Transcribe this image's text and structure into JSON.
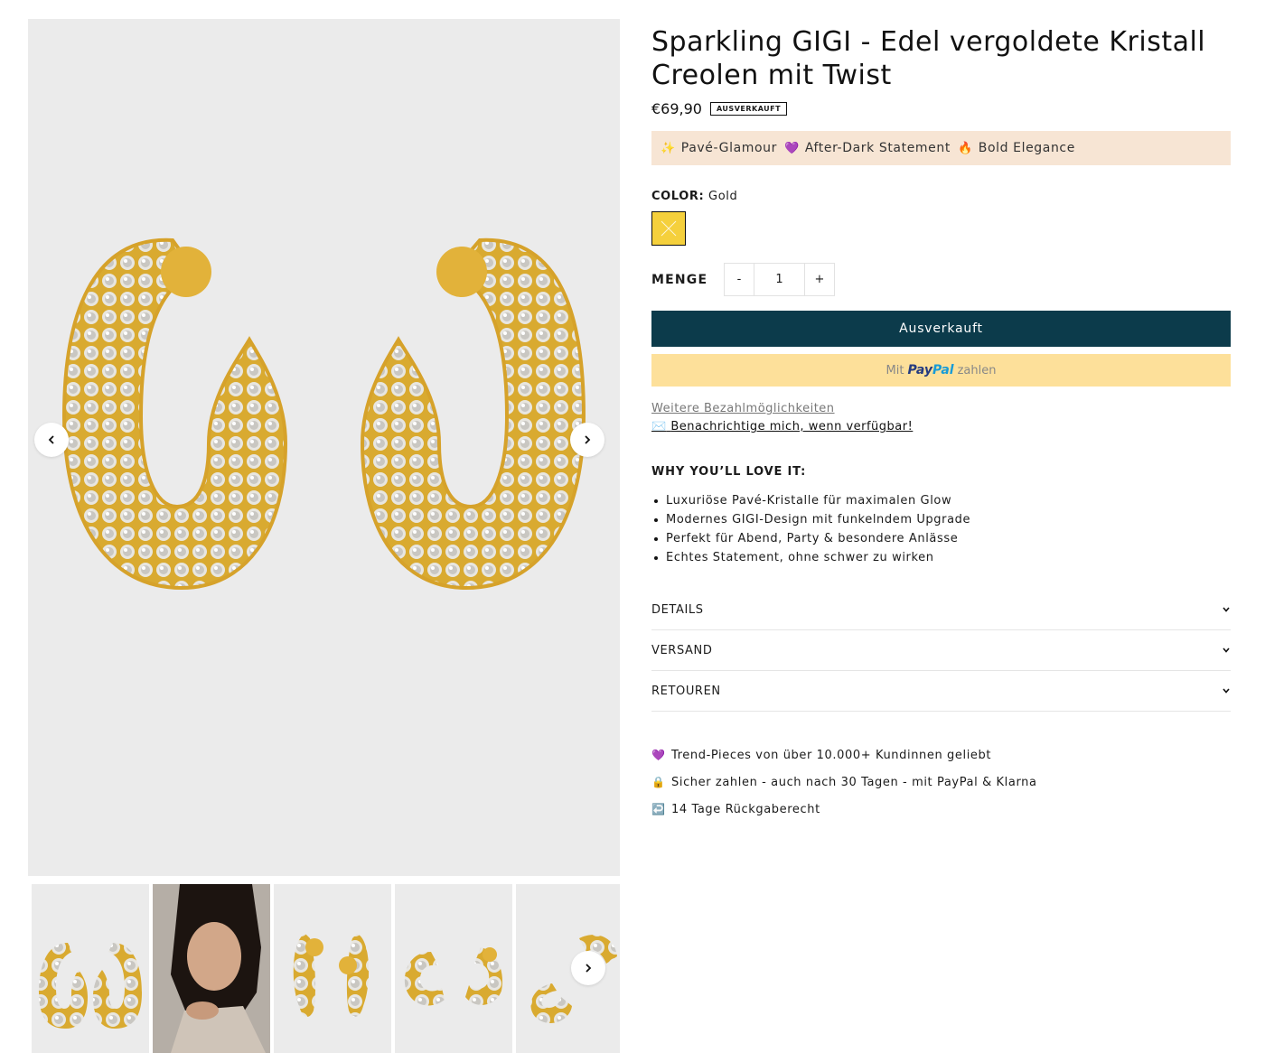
{
  "product": {
    "title": "Sparkling GIGI - Edel vergoldete Kristall Creolen mit Twist",
    "price": "€69,90",
    "badge": "AUSVERKAUFT"
  },
  "promo": [
    {
      "icon": "✨",
      "icon_name": "sparkles-icon",
      "text": "Pavé-Glamour"
    },
    {
      "icon": "💜",
      "icon_name": "heart-icon",
      "text": "After-Dark Statement"
    },
    {
      "icon": "🔥",
      "icon_name": "fire-icon",
      "text": "Bold Elegance"
    }
  ],
  "color": {
    "label": "COLOR:",
    "value": "Gold",
    "swatch": "#f5d03c"
  },
  "quantity": {
    "label": "MENGE",
    "minus": "-",
    "value": "1",
    "plus": "+"
  },
  "buttons": {
    "sold_out": "Ausverkauft",
    "paypal_prefix": "Mit",
    "paypal_brand_pay": "Pay",
    "paypal_brand_pal": "Pal",
    "paypal_suffix": "zahlen"
  },
  "links": {
    "more_payment": "Weitere Bezahlmöglichkeiten",
    "notify_icon": "✉️",
    "notify": "Benachrichtige mich, wenn verfügbar!"
  },
  "why": {
    "heading": "WHY YOU’LL LOVE IT:",
    "bullets": [
      "Luxuriöse Pavé-Kristalle für maximalen Glow",
      "Modernes GIGI-Design mit funkelndem Upgrade",
      "Perfekt für Abend, Party & besondere Anlässe",
      "Echtes Statement, ohne schwer zu wirken"
    ]
  },
  "accordion": [
    "DETAILS",
    "VERSAND",
    "RETOUREN"
  ],
  "trust": [
    {
      "icon": "💜",
      "icon_name": "heart-icon",
      "text": "Trend-Pieces von über 10.000+ Kundinnen geliebt"
    },
    {
      "icon": "🔒",
      "icon_name": "lock-icon",
      "text": "Sicher zahlen - auch nach 30 Tagen - mit PayPal & Klarna"
    },
    {
      "icon": "↩️",
      "icon_name": "return-icon",
      "text": "14 Tage Rückgaberecht"
    }
  ],
  "colors": {
    "accent": "#0c3b4b",
    "paypal_bg": "#fde09a",
    "promo_bg": "#f7e5d4",
    "gallery_bg": "#ebebeb",
    "gold": "#e2b23a"
  }
}
